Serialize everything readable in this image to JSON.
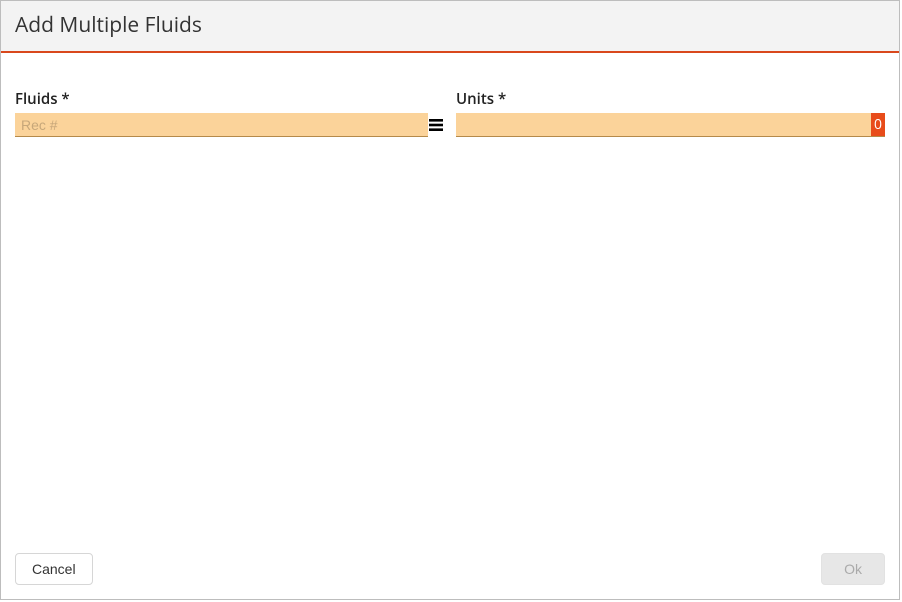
{
  "dialog": {
    "title": "Add Multiple Fluids"
  },
  "fields": {
    "fluids": {
      "label": "Fluids *",
      "placeholder": "Rec #",
      "value": ""
    },
    "units": {
      "label": "Units *",
      "value": "",
      "highlight": "0"
    }
  },
  "buttons": {
    "cancel": "Cancel",
    "ok": "Ok"
  }
}
